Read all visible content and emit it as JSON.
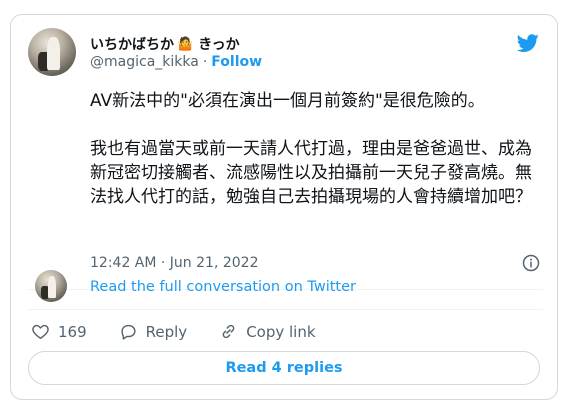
{
  "author": {
    "display_name": "いちかばちか",
    "display_emoji": "🤷",
    "display_suffix": "きっか",
    "handle": "@magica_kikka",
    "separator": "·",
    "follow_label": "Follow"
  },
  "tweet": {
    "text": "AV新法中的\"必須在演出一個月前簽約\"是很危險的。\n\n我也有過當天或前一天請人代打過，理由是爸爸過世、成為新冠密切接觸者、流感陽性以及拍攝前一天兒子發高燒。無法找人代打的話，勉強自己去拍攝現場的人會持續增加吧？",
    "timestamp": "12:42 AM · Jun 21, 2022"
  },
  "conversation": {
    "link_label": "Read the full conversation on Twitter"
  },
  "actions": {
    "like_count": "169",
    "reply_label": "Reply",
    "copy_link_label": "Copy link"
  },
  "read_replies_label": "Read 4 replies",
  "colors": {
    "accent": "#1d9bf0",
    "muted": "#536471",
    "border": "#cfd9de"
  },
  "icons": [
    "twitter-bird-icon",
    "info-icon",
    "heart-icon",
    "reply-icon",
    "link-icon"
  ]
}
